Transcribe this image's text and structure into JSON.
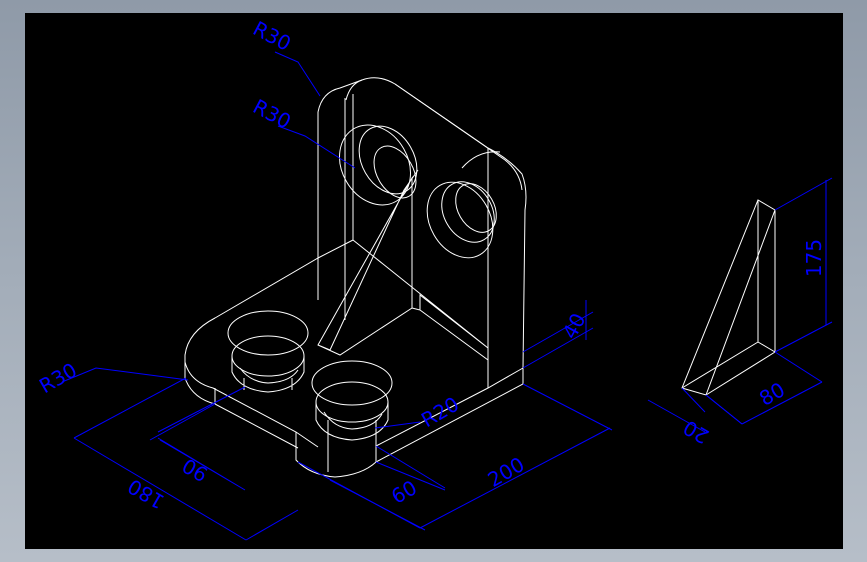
{
  "colors": {
    "background": "#000000",
    "geometry": "#ffffff",
    "dimensions": "#0000ff",
    "frame": "#9aa4b1"
  },
  "dimensions": {
    "r30_top": "R30",
    "r30_hole": "R30",
    "r30_base": "R30",
    "r20": "R20",
    "d40": "40",
    "d90": "90",
    "d180": "180",
    "d60": "60",
    "d200": "200",
    "d175": "175",
    "d80": "80",
    "d20": "20"
  }
}
